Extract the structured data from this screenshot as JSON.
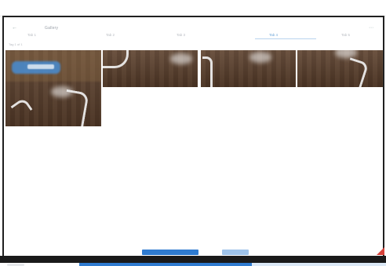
{
  "window": {
    "title": "Gallery",
    "tabs": [
      "Tab 1",
      "Tab 2",
      "Tab 3",
      "Tab 4",
      "Tab 5"
    ],
    "active_tab_index": 3,
    "label": "Tag 1 of 1"
  },
  "gallery": {
    "items": [
      {
        "name": "photo-1"
      },
      {
        "name": "photo-2"
      },
      {
        "name": "photo-3"
      },
      {
        "name": "photo-4"
      }
    ]
  },
  "actions": {
    "primary_label": "",
    "secondary_label": ""
  },
  "progress": {
    "value": 0.56
  },
  "colors": {
    "accent": "#2f7bd0",
    "accent_light": "#9fc3ea",
    "border_dark": "#202020",
    "corner_red": "#d6423a"
  }
}
